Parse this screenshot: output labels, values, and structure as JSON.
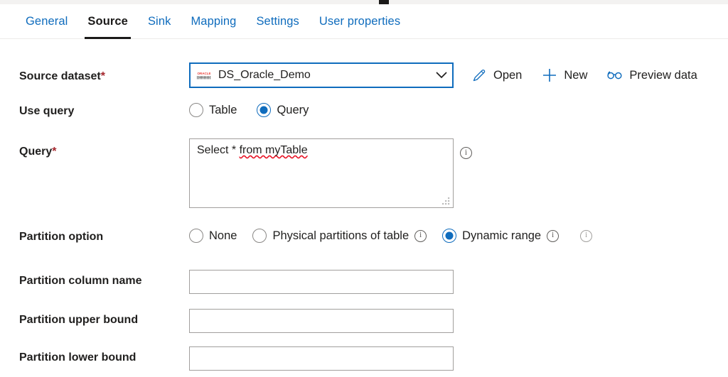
{
  "window": {
    "top_marker": "tab-indicator"
  },
  "tabs": [
    {
      "label": "General",
      "selected": false
    },
    {
      "label": "Source",
      "selected": true
    },
    {
      "label": "Sink",
      "selected": false
    },
    {
      "label": "Mapping",
      "selected": false
    },
    {
      "label": "Settings",
      "selected": false
    },
    {
      "label": "User properties",
      "selected": false
    }
  ],
  "form": {
    "source_dataset": {
      "label": "Source dataset",
      "required_marker": "*",
      "value": "DS_Oracle_Demo",
      "icon": "oracle-logo-icon",
      "chevron": "chevron-down-icon"
    },
    "commands": [
      {
        "label": "Open",
        "icon": "pencil-icon"
      },
      {
        "label": "New",
        "icon": "plus-icon"
      },
      {
        "label": "Preview data",
        "icon": "glasses-icon"
      }
    ],
    "use_query": {
      "label": "Use query",
      "options": [
        {
          "label": "Table",
          "checked": false
        },
        {
          "label": "Query",
          "checked": true
        }
      ]
    },
    "query": {
      "label": "Query",
      "required_marker": "*",
      "value_plain": "Select * from myTable",
      "value_prefix": "Select * ",
      "value_misspelled": "from myTable",
      "info": "i"
    },
    "partition_option": {
      "label": "Partition option",
      "options": [
        {
          "label": "None",
          "checked": false,
          "info": ""
        },
        {
          "label": "Physical partitions of table",
          "checked": false,
          "info": "i"
        },
        {
          "label": "Dynamic range",
          "checked": true,
          "info": "i"
        }
      ],
      "trailing_info": "i"
    },
    "fields": [
      {
        "label": "Partition column name",
        "value": "",
        "placeholder": ""
      },
      {
        "label": "Partition upper bound",
        "value": "",
        "placeholder": ""
      },
      {
        "label": "Partition lower bound",
        "value": "",
        "placeholder": ""
      }
    ]
  },
  "colors": {
    "accent": "#0f6cbd",
    "text": "#201f1e",
    "required": "#a4262c",
    "spellcheck": "#e81123",
    "border": "#a19f9d",
    "oracle_red": "#ea3a33"
  }
}
